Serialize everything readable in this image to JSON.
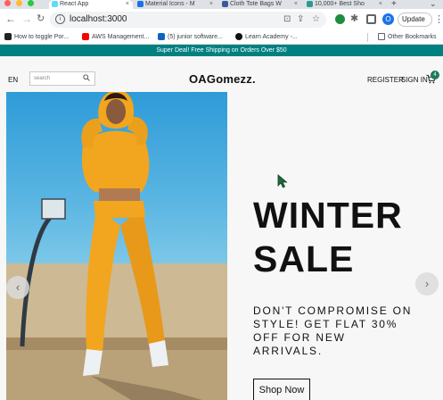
{
  "browser": {
    "tabs": [
      {
        "title": "React App",
        "active": true,
        "favicon_color": "#61dafb"
      },
      {
        "title": "Material Icons - M",
        "active": false,
        "favicon_color": "#1a73e8"
      },
      {
        "title": "Cloth Tote Bags W",
        "active": false,
        "favicon_color": "#3b5998"
      },
      {
        "title": "10,000+ Best Sho",
        "active": false,
        "favicon_color": "#2a9d8f"
      }
    ],
    "close_glyph": "×",
    "new_tab_glyph": "+",
    "tab_overflow_glyph": "⌄",
    "url": "localhost:3000",
    "profile_initial": "O",
    "update_label": "Update",
    "bookmarks": [
      {
        "label": "How to toggle Por...",
        "icon_color": "#222222"
      },
      {
        "label": "AWS Management...",
        "icon_color": "#f90000"
      },
      {
        "label": "(5) junior software...",
        "icon_color": "#0a66c2"
      },
      {
        "label": "Learn Academy -...",
        "icon_color": "#111111"
      }
    ],
    "other_bookmarks_label": "Other Bookmarks"
  },
  "page": {
    "promo_text": "Super Deal! Free Shipping on Orders Over $50",
    "nav": {
      "language": "EN",
      "search_placeholder": "search",
      "logo": "OAGomezz.",
      "register": "REGISTER",
      "signin": "SIGN IN",
      "cart_count": "4"
    },
    "hero": {
      "title_line1": "WINTER",
      "title_line2": "SALE",
      "description": "DON'T COMPROMISE ON STYLE! GET FLAT 30% OFF FOR NEW ARRIVALS.",
      "cta": "Shop Now",
      "prev_arrow": "‹",
      "next_arrow": "›"
    }
  },
  "colors": {
    "promo_bg": "#008080",
    "cart_badge": "#1e7a5a",
    "outfit": "#f2a51e"
  }
}
